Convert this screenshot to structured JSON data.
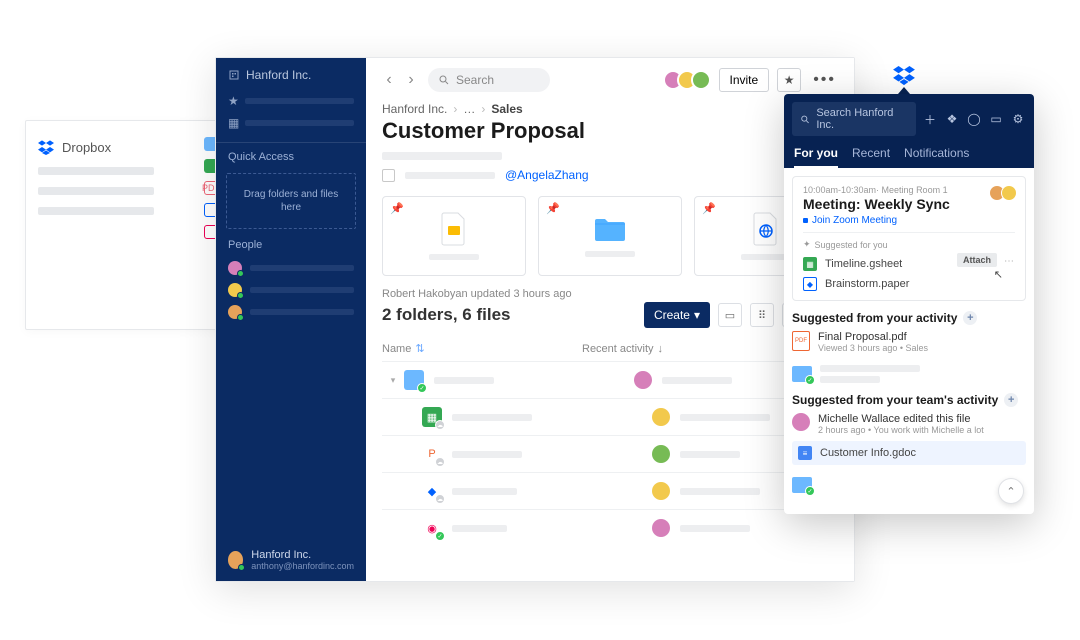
{
  "bg_sidebar_label": "Dropbox",
  "sidebar": {
    "brand": "Hanford Inc.",
    "quick_access_label": "Quick Access",
    "dropzone_text": "Drag folders and files here",
    "people_label": "People",
    "footer_name": "Hanford Inc.",
    "footer_email": "anthony@hanfordinc.com"
  },
  "topbar": {
    "search_placeholder": "Search",
    "invite_label": "Invite"
  },
  "breadcrumb": {
    "root": "Hanford Inc.",
    "mid": "…",
    "current": "Sales"
  },
  "page_title": "Customer Proposal",
  "mention": "@AngelaZhang",
  "updated_line": "Robert Hakobyan updated 3 hours ago",
  "summary": "2 folders, 6 files",
  "create_label": "Create",
  "table": {
    "col_name": "Name",
    "col_recent": "Recent activity"
  },
  "panel": {
    "search_placeholder": "Search Hanford Inc.",
    "tabs": {
      "for_you": "For you",
      "recent": "Recent",
      "notifications": "Notifications"
    },
    "event": {
      "meta": "10:00am-10:30am· Meeting Room 1",
      "title": "Meeting: Weekly Sync",
      "link": "Join Zoom Meeting",
      "suggested_label": "Suggested for you",
      "file1": "Timeline.gsheet",
      "file2": "Brainstorm.paper",
      "attach_label": "Attach"
    },
    "section_activity": "Suggested from your activity",
    "activity_file": {
      "name": "Final Proposal.pdf",
      "meta": "Viewed 3 hours ago • Sales"
    },
    "section_team": "Suggested from your team's activity",
    "team_item": {
      "line1": "Michelle Wallace edited this file",
      "line2": "2 hours ago • You work with Michelle a lot"
    },
    "gdoc_name": "Customer Info.gdoc"
  }
}
